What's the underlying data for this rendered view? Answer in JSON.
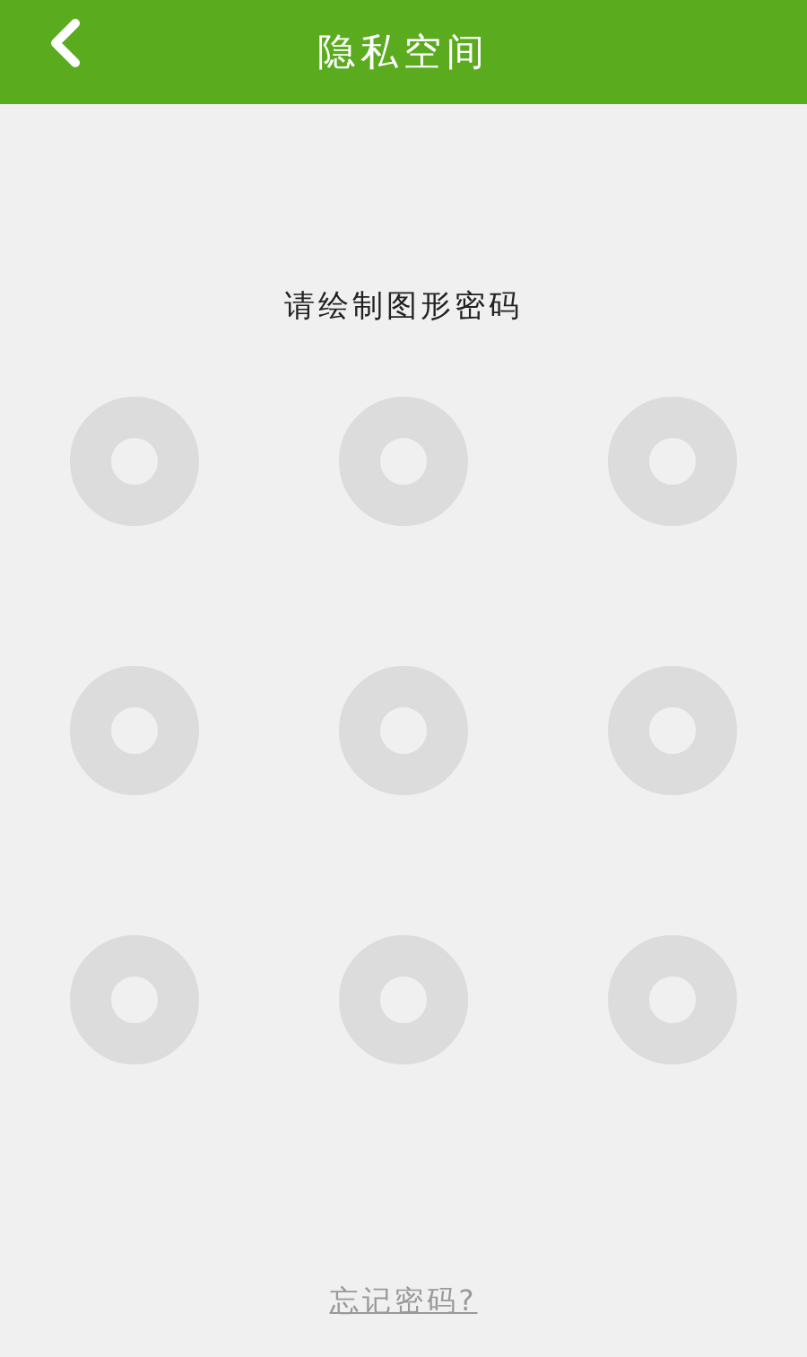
{
  "header": {
    "title": "隐私空间"
  },
  "prompt": "请绘制图形密码",
  "pattern_dots": [
    {
      "selected": false
    },
    {
      "selected": false
    },
    {
      "selected": false
    },
    {
      "selected": false
    },
    {
      "selected": false
    },
    {
      "selected": false
    },
    {
      "selected": false
    },
    {
      "selected": false
    },
    {
      "selected": false
    }
  ],
  "forgot_link": "忘记密码?"
}
